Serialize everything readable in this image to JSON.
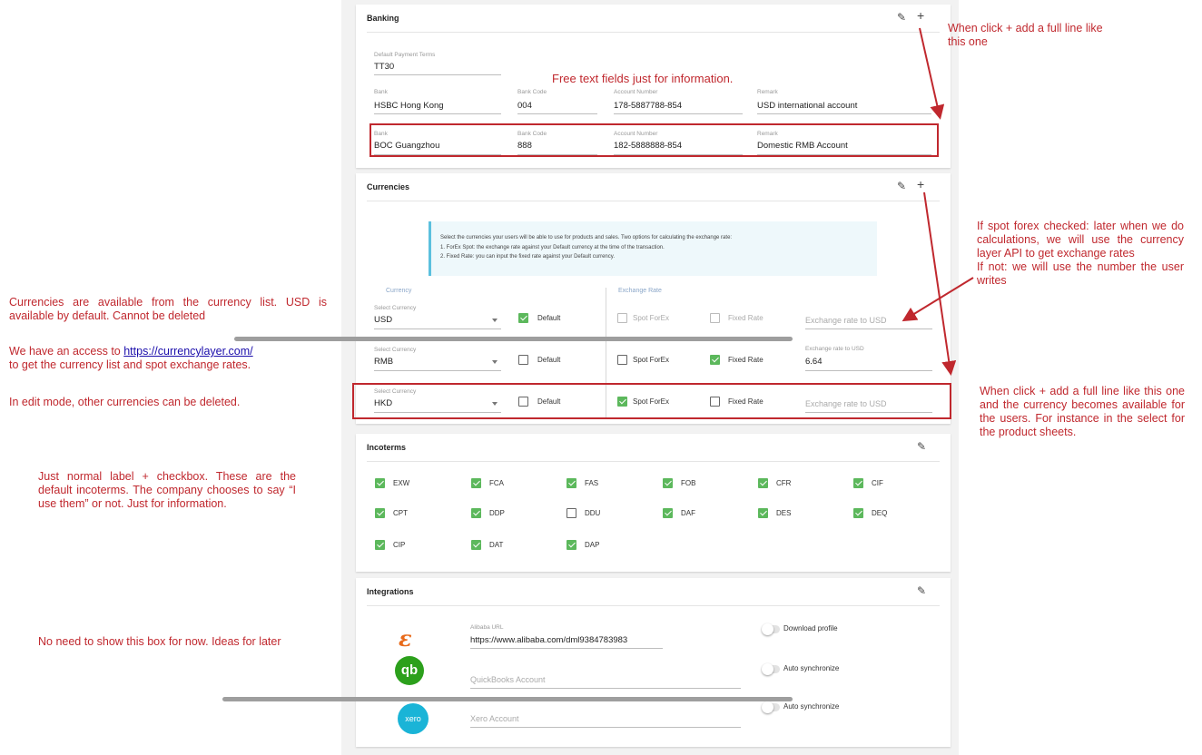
{
  "banking": {
    "title": "Banking",
    "payment_terms_label": "Default Payment Terms",
    "payment_terms_value": "TT30",
    "free_text_note": "Free text fields just for information.",
    "labels": {
      "bank": "Bank",
      "code": "Bank Code",
      "account": "Account Number",
      "remark": "Remark"
    },
    "rows": [
      {
        "bank": "HSBC Hong Kong",
        "code": "004",
        "account": "178-5887788-854",
        "remark": "USD international account"
      },
      {
        "bank": "BOC Guangzhou",
        "code": "888",
        "account": "182-5888888-854",
        "remark": "Domestic RMB Account"
      }
    ]
  },
  "currencies": {
    "title": "Currencies",
    "info_line1": "Select the currencies your users will be able to use for products and sales. Two options for calculating the exchange rate:",
    "info_line2": "1. ForEx Spot: the exchange rate against your Default currency at the time of the transaction.",
    "info_line3": "2. Fixed Rate: you can input the fixed rate against your Default currency.",
    "col_currency": "Currency",
    "col_exchange": "Exchange Rate",
    "select_label": "Select Currency",
    "default_label": "Default",
    "spot_label": "Spot ForEx",
    "fixed_label": "Fixed Rate",
    "rate_label": "Exchange rate to USD",
    "rows": [
      {
        "currency": "USD",
        "default": true,
        "spot": false,
        "fixed": false,
        "rate": ""
      },
      {
        "currency": "RMB",
        "default": false,
        "spot": false,
        "fixed": true,
        "rate": "6.64"
      },
      {
        "currency": "HKD",
        "default": false,
        "spot": true,
        "fixed": false,
        "rate": ""
      }
    ]
  },
  "incoterms": {
    "title": "Incoterms",
    "items": [
      {
        "label": "EXW",
        "checked": true
      },
      {
        "label": "FCA",
        "checked": true
      },
      {
        "label": "FAS",
        "checked": true
      },
      {
        "label": "FOB",
        "checked": true
      },
      {
        "label": "CFR",
        "checked": true
      },
      {
        "label": "CIF",
        "checked": true
      },
      {
        "label": "CPT",
        "checked": true
      },
      {
        "label": "DDP",
        "checked": true
      },
      {
        "label": "DDU",
        "checked": false
      },
      {
        "label": "DAF",
        "checked": true
      },
      {
        "label": "DES",
        "checked": true
      },
      {
        "label": "DEQ",
        "checked": true
      },
      {
        "label": "CIP",
        "checked": true
      },
      {
        "label": "DAT",
        "checked": true
      },
      {
        "label": "DAP",
        "checked": true
      }
    ]
  },
  "integrations": {
    "title": "Integrations",
    "alibaba_label": "Alibaba URL",
    "alibaba_value": "https://www.alibaba.com/dml9384783983",
    "alibaba_logo": "ε",
    "quickbooks_placeholder": "QuickBooks Account",
    "quickbooks_logo": "qb",
    "xero_placeholder": "Xero Account",
    "xero_logo": "xero",
    "toggle_download": "Download profile",
    "toggle_sync1": "Auto synchronize",
    "toggle_sync2": "Auto synchronize"
  },
  "notes": {
    "banking_plus": "When click + add a full line like this one",
    "spot_forex": "If spot forex checked: later when we do calculations, we will use the currency layer API to get exchange rates\nIf not: we will use the number the user writes",
    "currency_plus": "When click + add a full line like this one and the currency becomes available for the users. For instance in the select for the product sheets.",
    "currencies_list": "Currencies are available from the currency list. USD is available by default. Cannot be deleted",
    "access_prefix": "We have an access to ",
    "access_link": "https://currencylayer.com/",
    "access_suffix": "to get the currency list and spot exchange rates.",
    "edit_mode": "In edit mode, other currencies can be deleted.",
    "incoterms_note": "Just normal label + checkbox. These are the default incoterms. The company chooses to say “I use them” or not. Just for information.",
    "integrations_note": "No need to show this box for now. Ideas for later"
  },
  "colors": {
    "annotation": "#c0282e",
    "check": "#5cb85c",
    "info_border": "#5bc0de"
  }
}
